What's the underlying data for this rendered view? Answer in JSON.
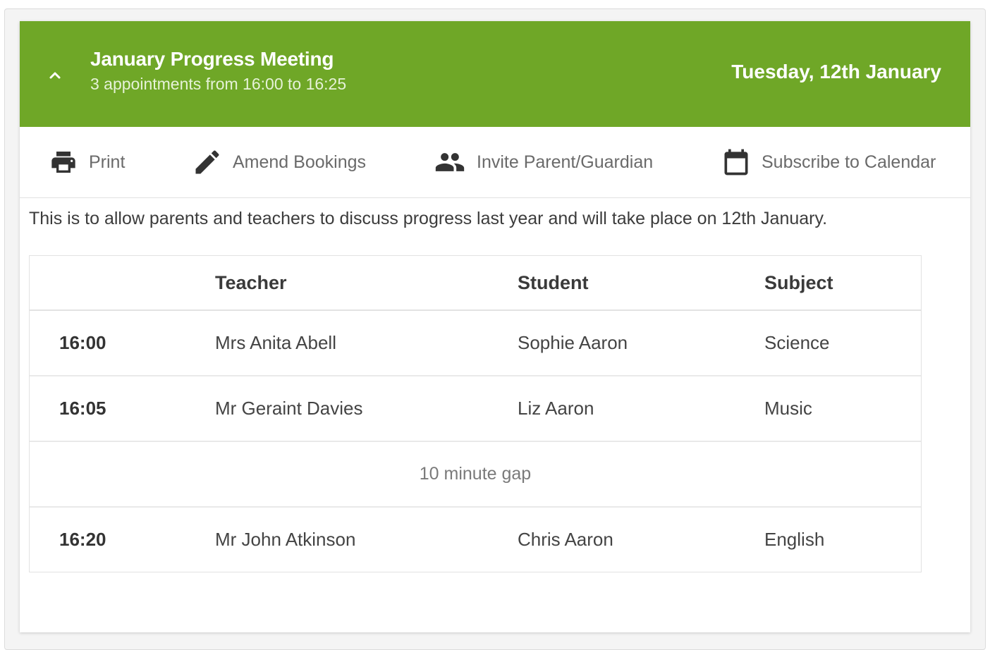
{
  "meeting": {
    "title": "January Progress Meeting",
    "subtitle": "3 appointments from 16:00 to 16:25",
    "date": "Tuesday, 12th January",
    "accent_color": "#6fa727",
    "collapse_icon": "chevron-up-icon"
  },
  "toolbar": {
    "print": {
      "label": "Print",
      "icon": "printer-icon"
    },
    "amend": {
      "label": "Amend Bookings",
      "icon": "pencil-icon"
    },
    "invite": {
      "label": "Invite Parent/Guardian",
      "icon": "people-icon"
    },
    "subscribe": {
      "label": "Subscribe to Calendar",
      "icon": "calendar-icon"
    }
  },
  "description": "This is to allow parents and teachers to discuss progress last year and will take place on 12th January.",
  "table": {
    "headers": {
      "time": "",
      "teacher": "Teacher",
      "student": "Student",
      "subject": "Subject"
    },
    "rows": [
      {
        "time": "16:00",
        "teacher": "Mrs Anita Abell",
        "student": "Sophie Aaron",
        "subject": "Science"
      },
      {
        "time": "16:05",
        "teacher": "Mr Geraint Davies",
        "student": "Liz Aaron",
        "subject": "Music"
      },
      {
        "gap": "10 minute gap"
      },
      {
        "time": "16:20",
        "teacher": "Mr John Atkinson",
        "student": "Chris Aaron",
        "subject": "English"
      }
    ]
  }
}
